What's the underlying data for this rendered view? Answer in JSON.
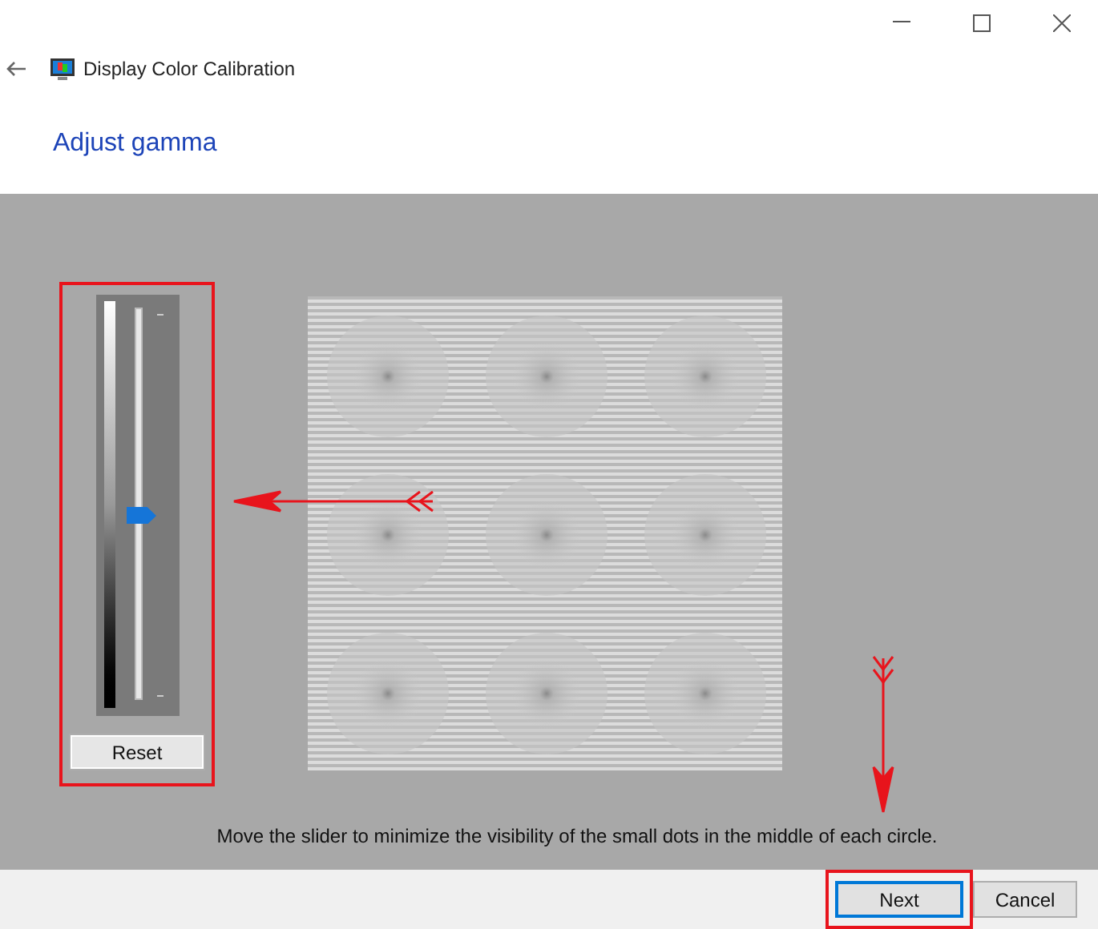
{
  "window": {
    "title": "Display Color Calibration"
  },
  "heading": "Adjust gamma",
  "gamma_slider": {
    "level": 0.47
  },
  "reset_button": "Reset",
  "instruction": "Move the slider to minimize the visibility of the small dots in the middle of each circle.",
  "buttons": [
    {
      "label": "Next",
      "default": true
    },
    {
      "label": "Cancel",
      "default": false
    }
  ]
}
